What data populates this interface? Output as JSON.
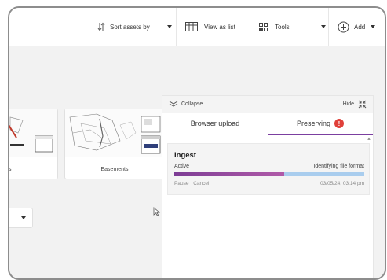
{
  "toolbar": {
    "sort_label": "Sort assets by",
    "view_label": "View as list",
    "tools_label": "Tools",
    "add_label": "Add"
  },
  "thumbnails": [
    {
      "caption": "s"
    },
    {
      "caption": "Easements"
    }
  ],
  "panel": {
    "collapse_label": "Collapse",
    "hide_label": "Hide",
    "tabs": [
      {
        "label": "Browser upload"
      },
      {
        "label": "Preserving",
        "badge": "!"
      }
    ],
    "job": {
      "title": "Ingest",
      "status": "Active",
      "detail": "Identifying file format",
      "progress": 0.58,
      "actions": [
        "Pause",
        "Cancel"
      ],
      "timestamp": "03/05/24, 03:14 pm"
    }
  },
  "colors": {
    "accent": "#7b3fa0",
    "progress_fill": "#8a3f9c",
    "progress_track": "#a9cdee",
    "alert": "#e0403a"
  }
}
